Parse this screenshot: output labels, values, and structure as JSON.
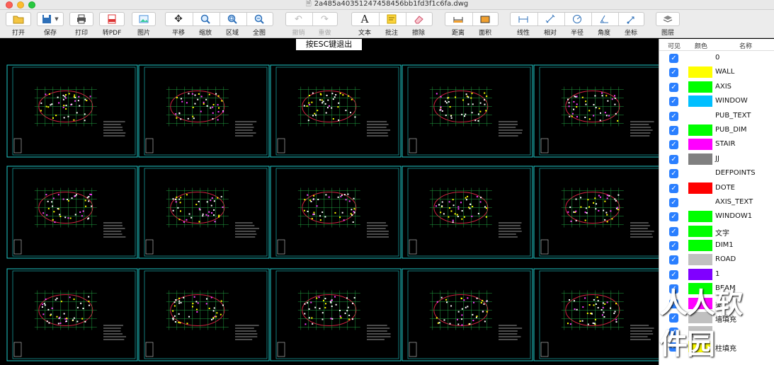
{
  "window": {
    "title": "2a485a40351247458456bb1fd3f1c6fa.dwg"
  },
  "toolbar": {
    "open": "打开",
    "save": "保存",
    "print": "打印",
    "topdf": "转PDF",
    "image": "图片",
    "pan": "平移",
    "zoom": "缩放",
    "region": "区域",
    "fit": "全图",
    "undo": "撤销",
    "redo": "重做",
    "text": "文本",
    "note": "批注",
    "erase": "擦除",
    "distance": "距离",
    "area": "面积",
    "linear": "线性",
    "relative": "相对",
    "radius": "半径",
    "angle": "角度",
    "coord": "坐标",
    "layers": "图层"
  },
  "canvas": {
    "esc_hint": "按ESC键退出"
  },
  "panel": {
    "head_visible": "可见",
    "head_color": "颜色",
    "head_name": "名称",
    "layers": [
      {
        "name": "0",
        "color": "#ffffff"
      },
      {
        "name": "WALL",
        "color": "#ffff00"
      },
      {
        "name": "AXIS",
        "color": "#00ff00"
      },
      {
        "name": "WINDOW",
        "color": "#00bfff"
      },
      {
        "name": "PUB_TEXT",
        "color": "#ffffff"
      },
      {
        "name": "PUB_DIM",
        "color": "#00ff00"
      },
      {
        "name": "STAIR",
        "color": "#ff00ff"
      },
      {
        "name": "JJ",
        "color": "#808080"
      },
      {
        "name": "DEFPOINTS",
        "color": "#ffffff"
      },
      {
        "name": "DOTE",
        "color": "#ff0000"
      },
      {
        "name": "AXIS_TEXT",
        "color": "#ffffff"
      },
      {
        "name": "WINDOW1",
        "color": "#00ff00"
      },
      {
        "name": "文字",
        "color": "#00ff00"
      },
      {
        "name": "DIM1",
        "color": "#00ff00"
      },
      {
        "name": "ROAD",
        "color": "#c0c0c0"
      },
      {
        "name": "1",
        "color": "#8000ff"
      },
      {
        "name": "BEAM",
        "color": "#00ff00"
      },
      {
        "name": "梁",
        "color": "#ff00ff"
      },
      {
        "name": "墙填充",
        "color": "#c0c0c0"
      },
      {
        "name": "",
        "color": "#c0c0c0"
      },
      {
        "name": "柱填充",
        "color": "#ffff00"
      }
    ]
  },
  "watermark": "人人软件园"
}
